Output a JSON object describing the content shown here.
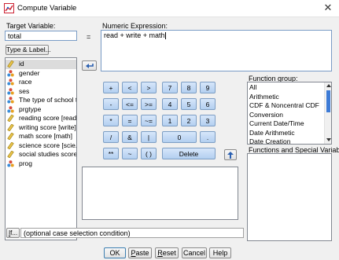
{
  "window": {
    "title": "Compute Variable",
    "close_glyph": "✕",
    "app_icon": "spss-app-icon"
  },
  "target": {
    "label": "Target Variable:",
    "value": "total",
    "type_label_button": "Type & Label..."
  },
  "equals": "=",
  "expression": {
    "label": "Numeric Expression:",
    "value": "read + write + math"
  },
  "variables": [
    {
      "name": "id",
      "icon": "scale-ruler-icon",
      "selected": true
    },
    {
      "name": "gender",
      "icon": "nominal-icon"
    },
    {
      "name": "race",
      "icon": "nominal-icon"
    },
    {
      "name": "ses",
      "icon": "nominal-icon"
    },
    {
      "name": "The type of school t...",
      "icon": "nominal-icon"
    },
    {
      "name": "prgtype",
      "icon": "nominal-icon"
    },
    {
      "name": "reading score [read]",
      "icon": "scale-ruler-icon"
    },
    {
      "name": "writing score [write]",
      "icon": "scale-ruler-icon"
    },
    {
      "name": "math score [math]",
      "icon": "scale-ruler-icon"
    },
    {
      "name": "science score [scie...",
      "icon": "scale-ruler-icon"
    },
    {
      "name": "social studies score...",
      "icon": "scale-ruler-icon"
    },
    {
      "name": "prog",
      "icon": "nominal-icon"
    }
  ],
  "keypad": {
    "row1": [
      "+",
      "<",
      ">",
      "7",
      "8",
      "9"
    ],
    "row2": [
      "-",
      "<=",
      ">=",
      "4",
      "5",
      "6"
    ],
    "row3": [
      "*",
      "=",
      "~=",
      "1",
      "2",
      "3"
    ],
    "row4": [
      "/",
      "&",
      "|",
      "0",
      "."
    ],
    "row5": [
      "**",
      "~",
      "( )",
      "Delete"
    ]
  },
  "function_group": {
    "label": "Function group:",
    "items": [
      "All",
      "Arithmetic",
      "CDF & Noncentral CDF",
      "Conversion",
      "Current Date/Time",
      "Date Arithmetic",
      "Date Creation"
    ]
  },
  "functions_label": "Functions and Special Variables:",
  "if_button": {
    "label": "If...",
    "condition": "(optional case selection condition)"
  },
  "buttons": {
    "ok": "OK",
    "paste": "Paste",
    "reset": "Reset",
    "cancel": "Cancel",
    "help": "Help"
  }
}
